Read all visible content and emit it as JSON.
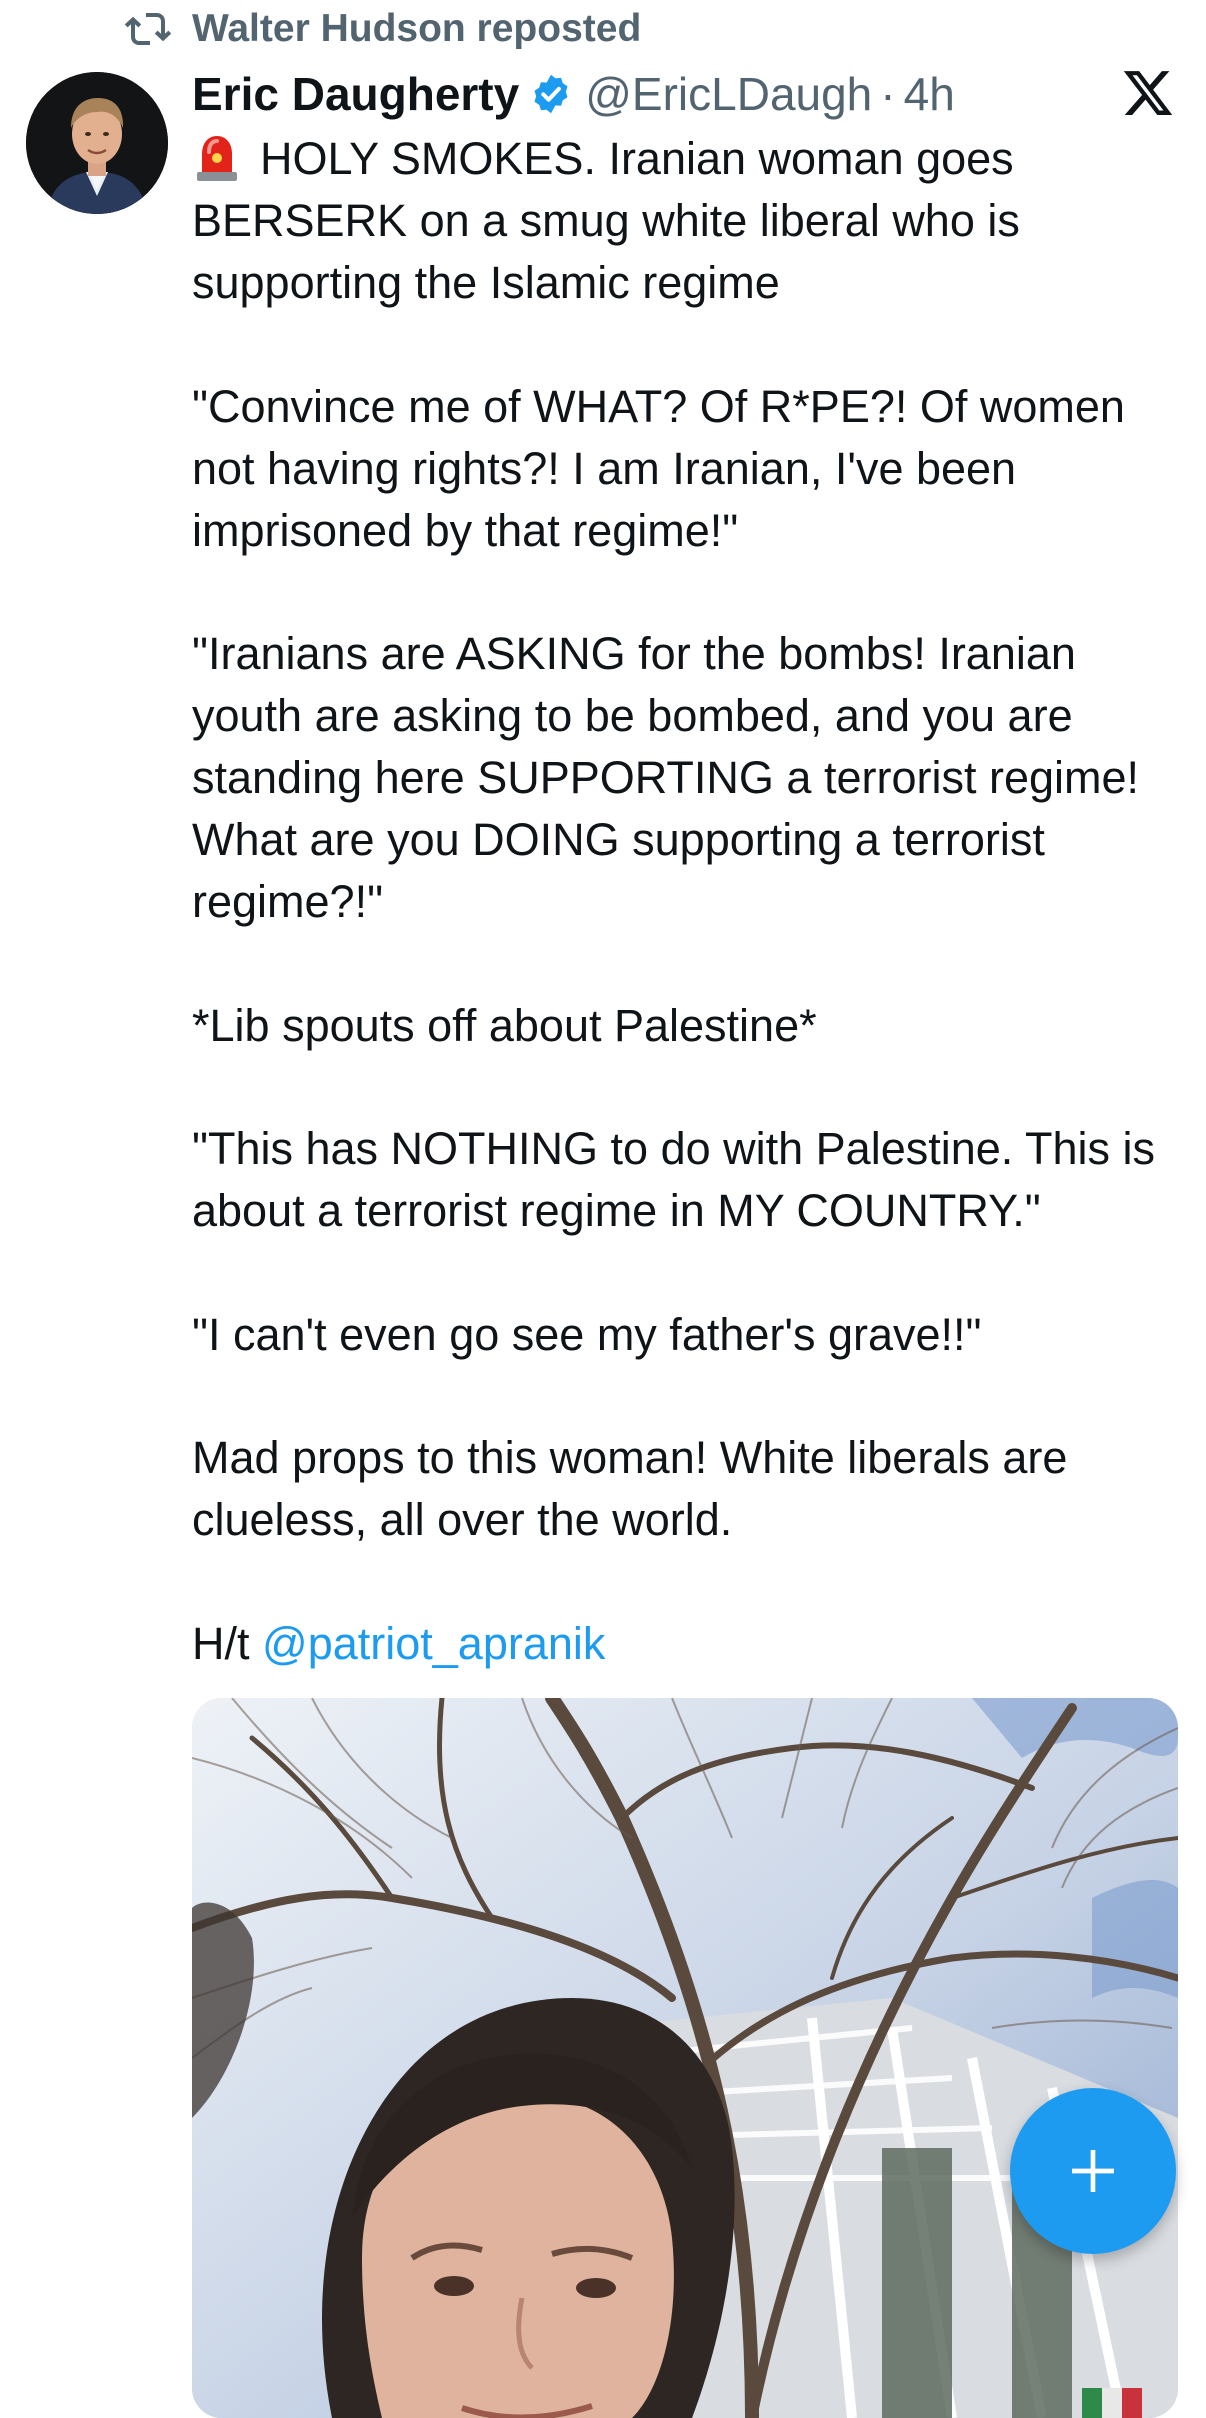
{
  "repost": {
    "label": "Walter Hudson reposted",
    "icon": "repost-icon"
  },
  "author": {
    "name": "Eric Daugherty",
    "handle": "@EricLDaugh",
    "separator": "·",
    "time": "4h",
    "verified": true
  },
  "post": {
    "para1": "HOLY SMOKES. Iranian woman goes BERSERK on a smug white liberal who is supporting the Islamic regime",
    "para2": "\"Convince me of WHAT? Of R*PE?! Of women not having rights?! I am Iranian, I've been imprisoned by that regime!\"",
    "para3": "\"Iranians are ASKING for the bombs! Iranian youth are asking to be bombed, and you are standing here SUPPORTING a terrorist regime! What are you DOING supporting a terrorist regime?!\"",
    "para4": "*Lib spouts off about Palestine*",
    "para5": "\"This has NOTHING to do with Palestine. This is about a terrorist regime in MY COUNTRY.\"",
    "para6": "\"I can't even go see my father's grave!!\"",
    "para7": "Mad props to this woman! White liberals are clueless, all over the world.",
    "hat_tip_prefix": "H/t ",
    "mention": "@patriot_apranik"
  },
  "colors": {
    "accent": "#1d9bf0",
    "secondary_text": "#536471",
    "text": "#0f1419"
  },
  "icons": [
    "repost-icon",
    "verified-badge-icon",
    "x-logo-icon",
    "siren-emoji-icon",
    "plus-icon"
  ]
}
